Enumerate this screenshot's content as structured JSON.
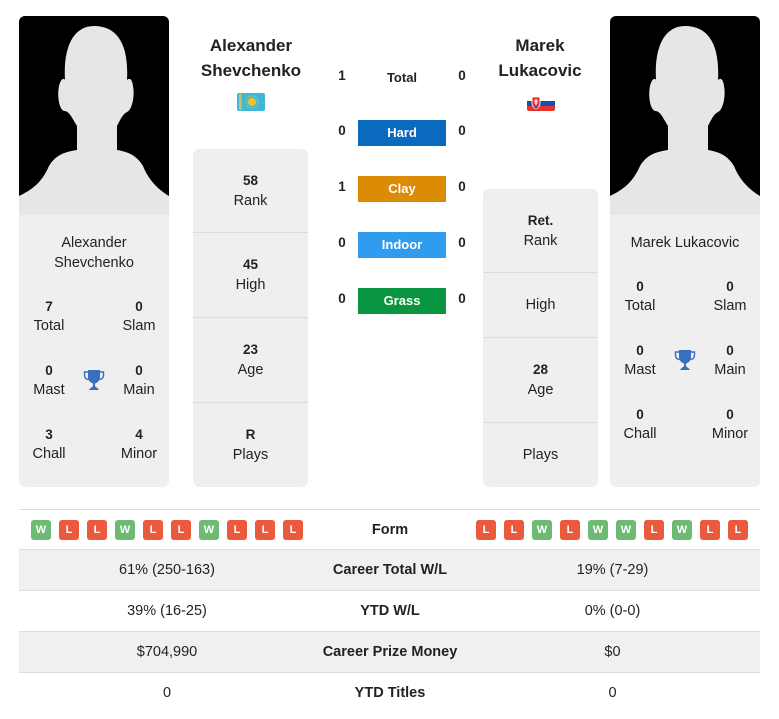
{
  "players": {
    "left": {
      "name_line1": "Alexander",
      "name_line2": "Shevchenko",
      "card_name_line1": "Alexander",
      "card_name_line2": "Shevchenko",
      "flag": "kazakhstan-flag",
      "titles": {
        "total": "7",
        "total_label": "Total",
        "slam": "0",
        "slam_label": "Slam",
        "mast": "0",
        "mast_label": "Mast",
        "main": "0",
        "main_label": "Main",
        "chall": "3",
        "chall_label": "Chall",
        "minor": "4",
        "minor_label": "Minor"
      },
      "stats": {
        "rank": "58",
        "rank_label": "Rank",
        "high": "45",
        "high_label": "High",
        "age": "23",
        "age_label": "Age",
        "plays": "R",
        "plays_label": "Plays"
      },
      "form": [
        "W",
        "L",
        "L",
        "W",
        "L",
        "L",
        "W",
        "L",
        "L",
        "L"
      ]
    },
    "right": {
      "name_line1": "Marek",
      "name_line2": "Lukacovic",
      "card_name": "Marek Lukacovic",
      "flag": "slovakia-flag",
      "titles": {
        "total": "0",
        "total_label": "Total",
        "slam": "0",
        "slam_label": "Slam",
        "mast": "0",
        "mast_label": "Mast",
        "main": "0",
        "main_label": "Main",
        "chall": "0",
        "chall_label": "Chall",
        "minor": "0",
        "minor_label": "Minor"
      },
      "stats": {
        "rank": "Ret.",
        "rank_label": "Rank",
        "high": "",
        "high_label": "High",
        "age": "28",
        "age_label": "Age",
        "plays": "",
        "plays_label": "Plays"
      },
      "form": [
        "L",
        "L",
        "W",
        "L",
        "W",
        "W",
        "L",
        "W",
        "L",
        "L"
      ]
    }
  },
  "h2h": {
    "total": {
      "label": "Total",
      "left": "1",
      "right": "0"
    },
    "surfaces": [
      {
        "label": "Hard",
        "left": "0",
        "right": "0",
        "color": "#0a6abf"
      },
      {
        "label": "Clay",
        "left": "1",
        "right": "0",
        "color": "#dc8b05"
      },
      {
        "label": "Indoor",
        "left": "0",
        "right": "0",
        "color": "#2f9cf0"
      },
      {
        "label": "Grass",
        "left": "0",
        "right": "0",
        "color": "#0a9640"
      }
    ]
  },
  "table": {
    "form_label": "Form",
    "rows": [
      {
        "label": "Career Total W/L",
        "left": "61% (250-163)",
        "right": "19% (7-29)"
      },
      {
        "label": "YTD W/L",
        "left": "39% (16-25)",
        "right": "0% (0-0)"
      },
      {
        "label": "Career Prize Money",
        "left": "$704,990",
        "right": "$0"
      },
      {
        "label": "YTD Titles",
        "left": "0",
        "right": "0"
      }
    ]
  },
  "colors": {
    "win": "#6dbb73",
    "loss": "#ec5a3d",
    "trophy": "#3a6fc0",
    "panel_bg": "#efefef"
  }
}
